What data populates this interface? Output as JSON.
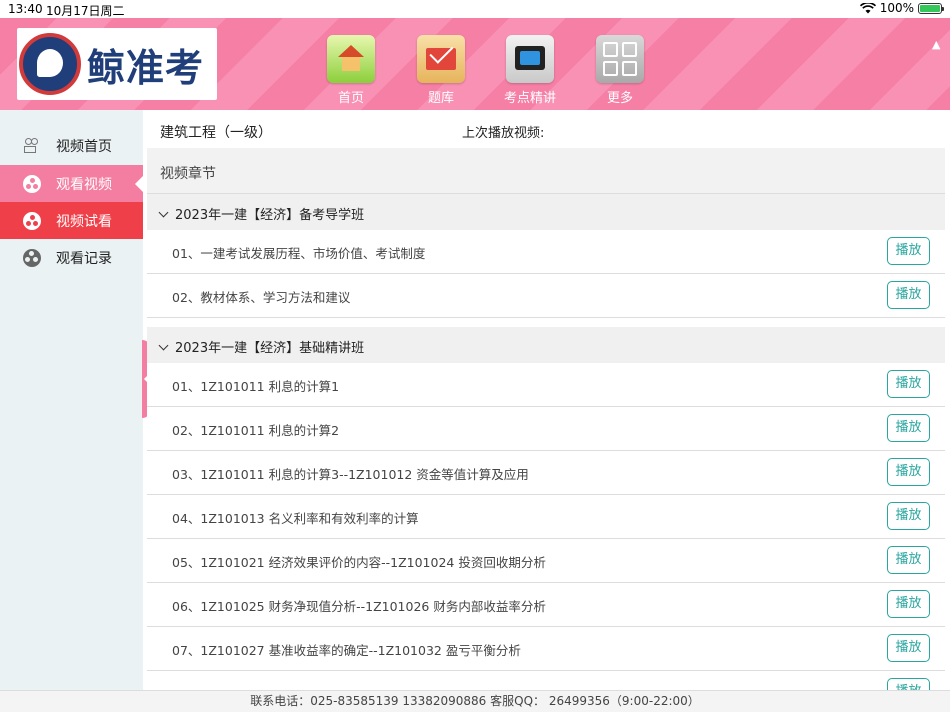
{
  "status_bar": {
    "time": "13:40",
    "date": "10月17日周二",
    "battery": "100%"
  },
  "header": {
    "brand": "鲸准考",
    "nav": [
      {
        "label": "首页",
        "icon": "home-icon"
      },
      {
        "label": "题库",
        "icon": "mail-icon"
      },
      {
        "label": "考点精讲",
        "icon": "video-screen-icon"
      },
      {
        "label": "更多",
        "icon": "grid-icon"
      }
    ]
  },
  "sidebar": {
    "items": [
      {
        "label": "视频首页",
        "icon": "camera-icon"
      },
      {
        "label": "观看视频",
        "icon": "film-reel-icon"
      },
      {
        "label": "视频试看",
        "icon": "film-reel-icon"
      },
      {
        "label": "观看记录",
        "icon": "film-reel-icon"
      }
    ]
  },
  "main": {
    "course": "建筑工程（一级）",
    "last_played_label": "上次播放视频:",
    "section_title": "视频章节",
    "play_label": "播放",
    "groups": [
      {
        "title": "2023年一建【经济】备考导学班",
        "items": [
          "01、一建考试发展历程、市场价值、考试制度",
          "02、教材体系、学习方法和建议"
        ]
      },
      {
        "title": "2023年一建【经济】基础精讲班",
        "items": [
          "01、1Z101011 利息的计算1",
          "02、1Z101011 利息的计算2",
          "03、1Z101011 利息的计算3--1Z101012 资金等值计算及应用",
          "04、1Z101013 名义利率和有效利率的计算",
          "05、1Z101021 经济效果评价的内容--1Z101024 投资回收期分析",
          "06、1Z101025 财务净现值分析--1Z101026 财务内部收益率分析",
          "07、1Z101027 基准收益率的确定--1Z101032 盈亏平衡分析"
        ]
      }
    ]
  },
  "footer": {
    "text": "联系电话：025-83585139  13382090886  客服QQ：  26499356（9:00-22:00）"
  },
  "colors": {
    "header_pink": "#f67fa6",
    "active_pink": "#f47ea1",
    "trial_red": "#ef3f48",
    "play_teal": "#2aa6a0",
    "brand_navy": "#1f3e7a"
  }
}
